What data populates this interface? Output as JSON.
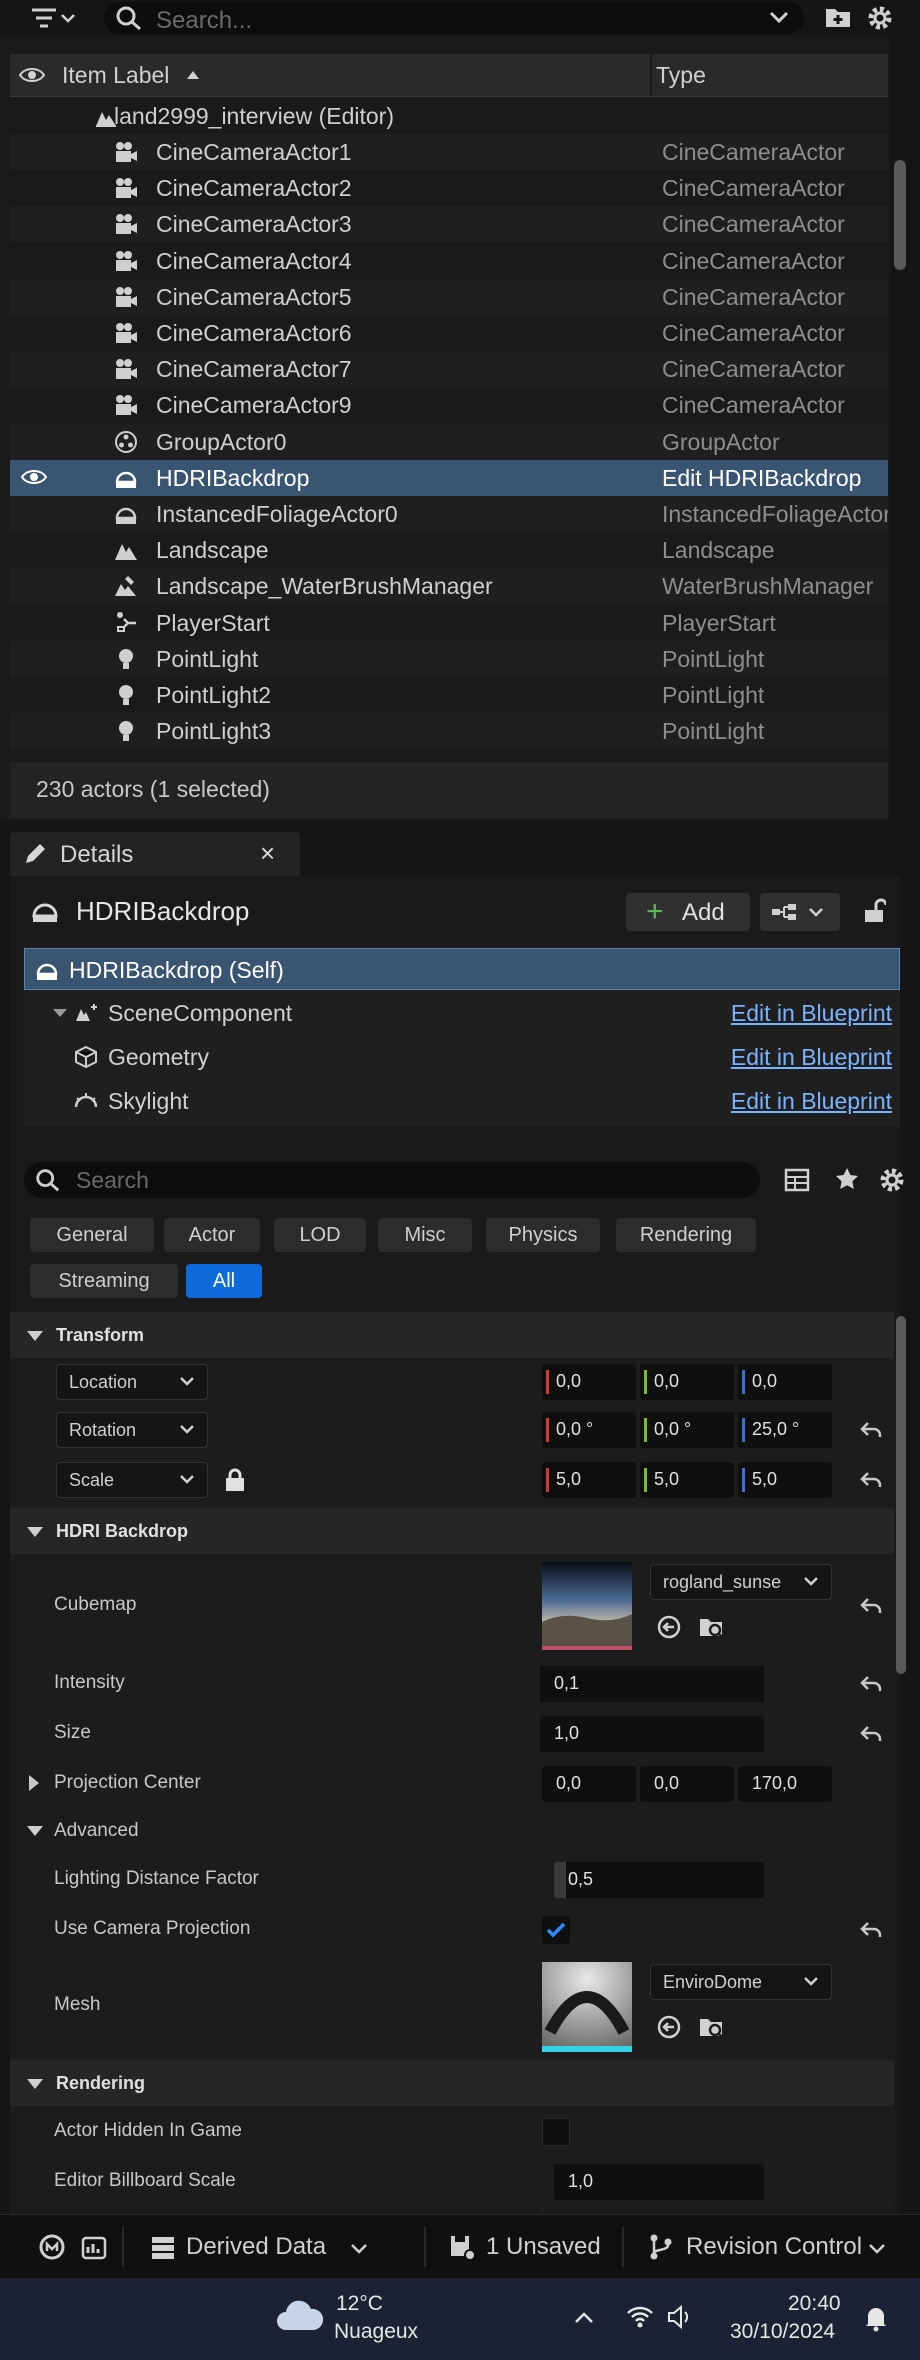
{
  "outliner": {
    "search_placeholder": "Search...",
    "col_label": "Item Label",
    "col_type": "Type",
    "root": "land2999_interview (Editor)",
    "rows": [
      {
        "name": "CineCameraActor1",
        "type": "CineCameraActor",
        "icon": "camera-icon"
      },
      {
        "name": "CineCameraActor2",
        "type": "CineCameraActor",
        "icon": "camera-icon"
      },
      {
        "name": "CineCameraActor3",
        "type": "CineCameraActor",
        "icon": "camera-icon"
      },
      {
        "name": "CineCameraActor4",
        "type": "CineCameraActor",
        "icon": "camera-icon"
      },
      {
        "name": "CineCameraActor5",
        "type": "CineCameraActor",
        "icon": "camera-icon"
      },
      {
        "name": "CineCameraActor6",
        "type": "CineCameraActor",
        "icon": "camera-icon"
      },
      {
        "name": "CineCameraActor7",
        "type": "CineCameraActor",
        "icon": "camera-icon"
      },
      {
        "name": "CineCameraActor9",
        "type": "CineCameraActor",
        "icon": "camera-icon"
      },
      {
        "name": "GroupActor0",
        "type": "GroupActor",
        "icon": "group-icon"
      },
      {
        "name": "HDRIBackdrop",
        "type": "Edit HDRIBackdrop",
        "icon": "hdri-icon",
        "selected": true
      },
      {
        "name": "InstancedFoliageActor0",
        "type": "InstancedFoliageActor",
        "icon": "foliage-icon"
      },
      {
        "name": "Landscape",
        "type": "Landscape",
        "icon": "landscape-icon"
      },
      {
        "name": "Landscape_WaterBrushManager",
        "type": "WaterBrushManager",
        "icon": "water-brush-icon"
      },
      {
        "name": "PlayerStart",
        "type": "PlayerStart",
        "icon": "player-start-icon"
      },
      {
        "name": "PointLight",
        "type": "PointLight",
        "icon": "light-bulb-icon"
      },
      {
        "name": "PointLight2",
        "type": "PointLight",
        "icon": "light-bulb-icon"
      },
      {
        "name": "PointLight3",
        "type": "PointLight",
        "icon": "light-bulb-icon"
      }
    ],
    "footer": "230 actors (1 selected)"
  },
  "details": {
    "tab": "Details",
    "tab_close": "×",
    "actor_name": "HDRIBackdrop",
    "add_label": "Add",
    "components": [
      {
        "name": "HDRIBackdrop (Self)",
        "edit": ""
      },
      {
        "name": "SceneComponent",
        "edit": "Edit in Blueprint"
      },
      {
        "name": "Geometry",
        "edit": "Edit in Blueprint"
      },
      {
        "name": "Skylight",
        "edit": "Edit in Blueprint"
      }
    ],
    "search_placeholder": "Search",
    "filters": [
      "General",
      "Actor",
      "LOD",
      "Misc",
      "Physics",
      "Rendering",
      "Streaming",
      "All"
    ],
    "active_filter": "All",
    "sections": {
      "transform": "Transform",
      "hdri": "HDRI Backdrop",
      "advanced": "Advanced",
      "rendering": "Rendering"
    },
    "transform": {
      "location_label": "Location",
      "location": [
        "0,0",
        "0,0",
        "0,0"
      ],
      "rotation_label": "Rotation",
      "rotation": [
        "0,0 °",
        "0,0 °",
        "25,0 °"
      ],
      "scale_label": "Scale",
      "scale": [
        "5,0",
        "5,0",
        "5,0"
      ]
    },
    "hdri": {
      "cubemap_label": "Cubemap",
      "cubemap_value": "rogland_sunse",
      "intensity_label": "Intensity",
      "intensity": "0,1",
      "size_label": "Size",
      "size": "1,0",
      "projection_center_label": "Projection Center",
      "projection_center": [
        "0,0",
        "0,0",
        "170,0"
      ]
    },
    "advanced": {
      "lighting_distance_label": "Lighting Distance Factor",
      "lighting_distance": "0,5",
      "use_camera_projection_label": "Use Camera Projection",
      "use_camera_projection": true,
      "mesh_label": "Mesh",
      "mesh_value": "EnviroDome"
    },
    "rendering": {
      "hidden_in_game_label": "Actor Hidden In Game",
      "hidden_in_game": false,
      "billboard_scale_label": "Editor Billboard Scale",
      "billboard_scale": "1,0"
    }
  },
  "statusbar": {
    "derived_data": "Derived Data",
    "unsaved": "1 Unsaved",
    "revision_control": "Revision Control"
  },
  "taskbar": {
    "temperature": "12°C",
    "weather": "Nuageux",
    "time": "20:40",
    "date": "30/10/2024"
  },
  "colors": {
    "selection": "#3a5572",
    "accent_blue": "#0e6bdc",
    "link_blue": "#7ab4ff",
    "axis_x": "#d23a3a",
    "axis_y": "#7dbb2f",
    "axis_z": "#3a6fd8"
  }
}
